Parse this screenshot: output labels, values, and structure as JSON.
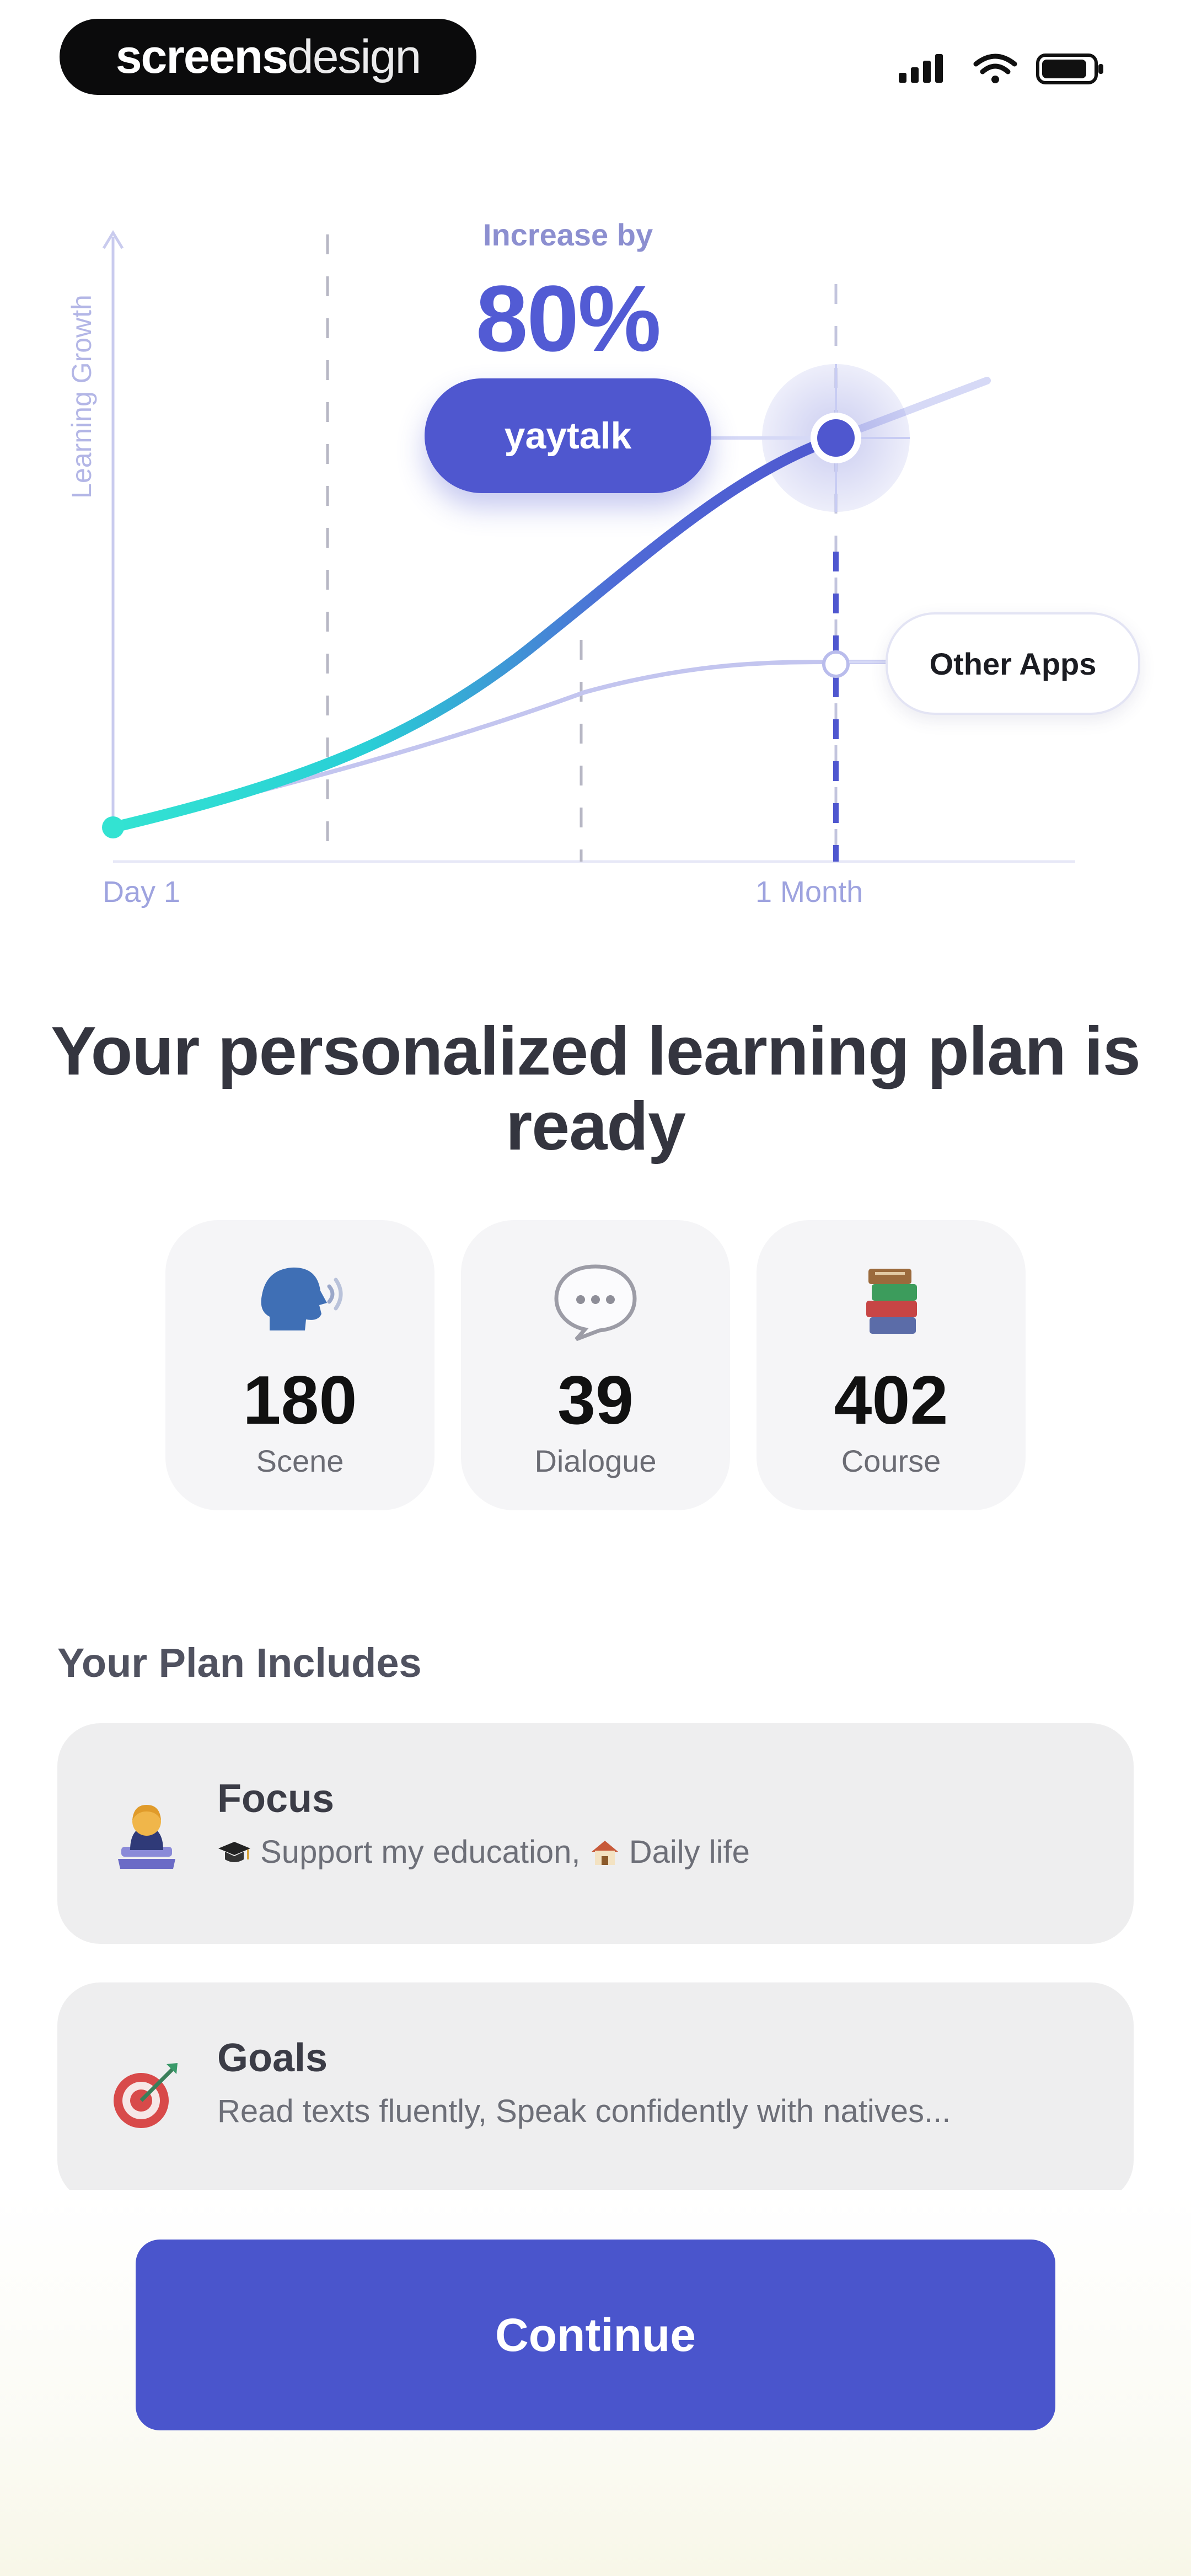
{
  "status_bar": {
    "brand_primary": "screens",
    "brand_secondary": "design",
    "icons": [
      "signal-icon",
      "wifi-icon",
      "battery-icon"
    ]
  },
  "chart": {
    "increase_label": "Increase by",
    "increase_value": "80%",
    "brand_label": "yaytalk",
    "other_label": "Other Apps",
    "y_axis_label": "Learning Growth",
    "x_start": "Day 1",
    "x_end": "1 Month"
  },
  "chart_data": {
    "type": "line",
    "title": "",
    "xlabel": "",
    "ylabel": "Learning Growth",
    "x": [
      "Day 1",
      "1 Month"
    ],
    "series": [
      {
        "name": "yaytalk",
        "values": [
          0,
          80
        ],
        "unit": "%"
      },
      {
        "name": "Other Apps",
        "values": [
          0,
          28
        ],
        "unit": "%"
      }
    ],
    "annotations": [
      "Increase by 80%"
    ],
    "grid": "vertical dashed",
    "colors": {
      "yaytalk_start": "#33e3d2",
      "yaytalk_end": "#4f57cf",
      "other": "#b9bcec"
    }
  },
  "headline": {
    "line1": "Your personalized learning plan is",
    "line2": "ready"
  },
  "stats": [
    {
      "icon": "speaking-head-icon",
      "value": "180",
      "label": "Scene"
    },
    {
      "icon": "speech-bubble-icon",
      "value": "39",
      "label": "Dialogue"
    },
    {
      "icon": "books-icon",
      "value": "402",
      "label": "Course"
    }
  ],
  "plan": {
    "title": "Your Plan Includes",
    "items": [
      {
        "icon": "student-icon",
        "title": "Focus",
        "desc_part1_icon": "graduation-cap-icon",
        "desc_part1": "Support my education,",
        "desc_part2_icon": "house-icon",
        "desc_part2": "Daily life"
      },
      {
        "icon": "target-icon",
        "title": "Goals",
        "desc": "Read texts fluently, Speak confidently with natives..."
      }
    ]
  },
  "cta": {
    "label": "Continue"
  },
  "colors": {
    "accent": "#4a55cc",
    "teal": "#33e3d2"
  }
}
